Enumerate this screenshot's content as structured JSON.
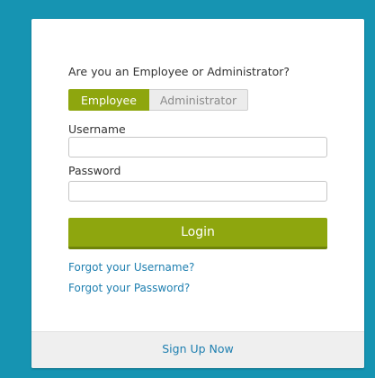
{
  "login_form": {
    "question": "Are you an Employee or Administrator?",
    "roles": {
      "employee": "Employee",
      "administrator": "Administrator",
      "selected": "Employee"
    },
    "username_label": "Username",
    "username_value": "",
    "password_label": "Password",
    "password_value": "",
    "login_label": "Login",
    "forgot_username": "Forgot your Username?",
    "forgot_password": "Forgot your Password?"
  },
  "footer": {
    "signup_label": "Sign Up Now"
  },
  "colors": {
    "background": "#1694b2",
    "accent": "#8ea60e",
    "link": "#1e7fb0"
  }
}
